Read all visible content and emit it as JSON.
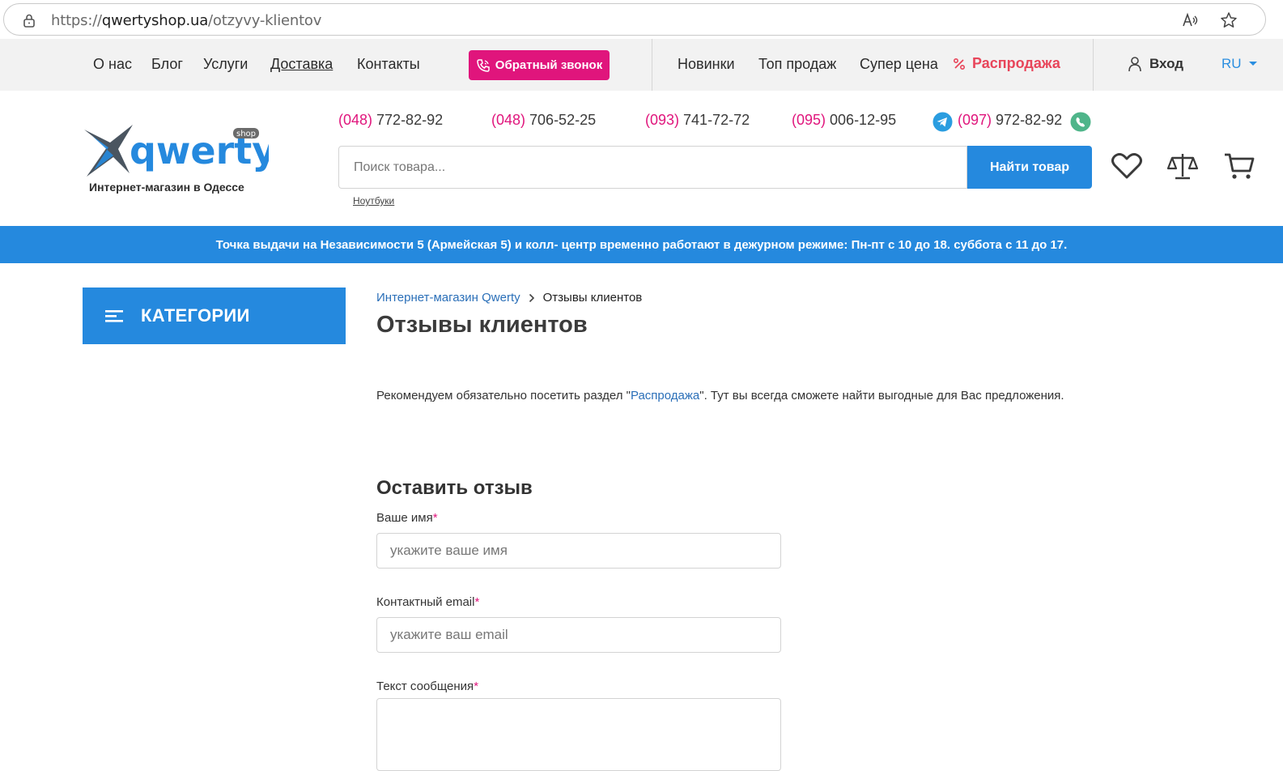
{
  "browser": {
    "url_prefix": "https://",
    "url_host": "qwertyshop.ua",
    "url_path": "/otzyvy-klientov"
  },
  "topnav": {
    "links": [
      "О нас",
      "Блог",
      "Услуги",
      "Доставка",
      "Контакты"
    ],
    "callback_label": "Обратный звонок",
    "right_links": [
      "Новинки",
      "Топ продаж",
      "Супер цена"
    ],
    "sale_label": "Распродажа",
    "login_label": "Вход",
    "lang_label": "RU"
  },
  "header": {
    "logo_text": "qwerty",
    "logo_badge": "shop",
    "logo_subtitle": "Интернет-магазин в Одессе",
    "phones": [
      {
        "code": "(048)",
        "number": " 772-82-92"
      },
      {
        "code": "(048)",
        "number": " 706-52-25"
      },
      {
        "code": "(093)",
        "number": " 741-72-72"
      },
      {
        "code": "(095)",
        "number": " 006-12-95"
      },
      {
        "code": "(097)",
        "number": " 972-82-92"
      }
    ],
    "search_placeholder": "Поиск товара...",
    "search_button": "Найти товар",
    "search_hint": "Ноутбуки"
  },
  "banner": {
    "text": "Точка выдачи на Независимости 5 (Армейская 5) и колл- центр временно работают в дежурном режиме: Пн-пт с 10 до 18. суббота с 11 до 17."
  },
  "sidebar": {
    "categories_label": "КАТЕГОРИИ"
  },
  "main": {
    "breadcrumb_home": "Интернет-магазин Qwerty",
    "breadcrumb_current": "Отзывы клиентов",
    "title": "Отзывы клиентов",
    "intro_before": "Рекомендуем обязательно посетить раздел \"",
    "intro_link": "Распродажа",
    "intro_after": "\". Тут вы всегда сможете найти выгодные для Вас предложения."
  },
  "form": {
    "title": "Оставить отзыв",
    "name_label": "Ваше имя",
    "name_placeholder": "укажите ваше имя",
    "email_label": "Контактный email",
    "email_placeholder": "укажите ваш email",
    "message_label": "Текст сообщения",
    "required_mark": "*"
  },
  "colors": {
    "accent_blue": "#2589de",
    "accent_pink": "#e0157c",
    "sale_red": "#e8455a"
  }
}
